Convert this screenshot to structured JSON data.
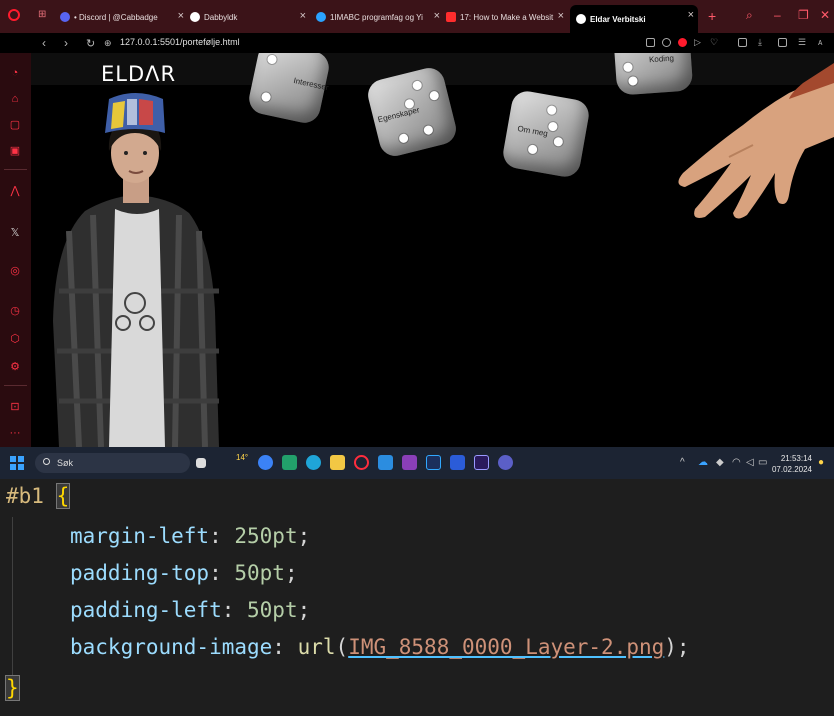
{
  "browser": {
    "tabs": [
      {
        "label": "• Discord | @Cabbadge",
        "color": "#5865f2"
      },
      {
        "label": "Dabbyldk",
        "color": "#ffffff"
      },
      {
        "label": "1IMABC programfag og Yi",
        "color": "#2aa3ff"
      },
      {
        "label": "17: How to Make a Websit",
        "color": "#ff2d2d"
      },
      {
        "label": "Eldar Verbitski",
        "color": "#ffffff",
        "active": true
      }
    ],
    "address": "127.0.0.1:5501/portefølje.html"
  },
  "page": {
    "logo": "ELDΛR",
    "dice": [
      {
        "label": "Interesser"
      },
      {
        "label": "Egenskaper"
      },
      {
        "label": "Om meg"
      },
      {
        "label": "Koding"
      }
    ]
  },
  "taskbar": {
    "search_placeholder": "Søk",
    "weather": "14°",
    "time": "21:53:14",
    "date": "07.02.2024"
  },
  "editor": {
    "selector": "#b1",
    "open_brace": "{",
    "close_brace": "}",
    "lines": [
      {
        "prop": "margin-left",
        "value": "250pt"
      },
      {
        "prop": "padding-top",
        "value": "50pt"
      },
      {
        "prop": "padding-left",
        "value": "50pt"
      },
      {
        "prop": "background-image",
        "fn": "url",
        "arg": "IMG_8588_0000_Layer-2.png"
      }
    ]
  },
  "colors": {
    "accent": "#ff1b2d",
    "tabbar_bg": "#3b1318",
    "taskbar_bg": "#1c2433",
    "editor_bg": "#1e1e1e"
  }
}
